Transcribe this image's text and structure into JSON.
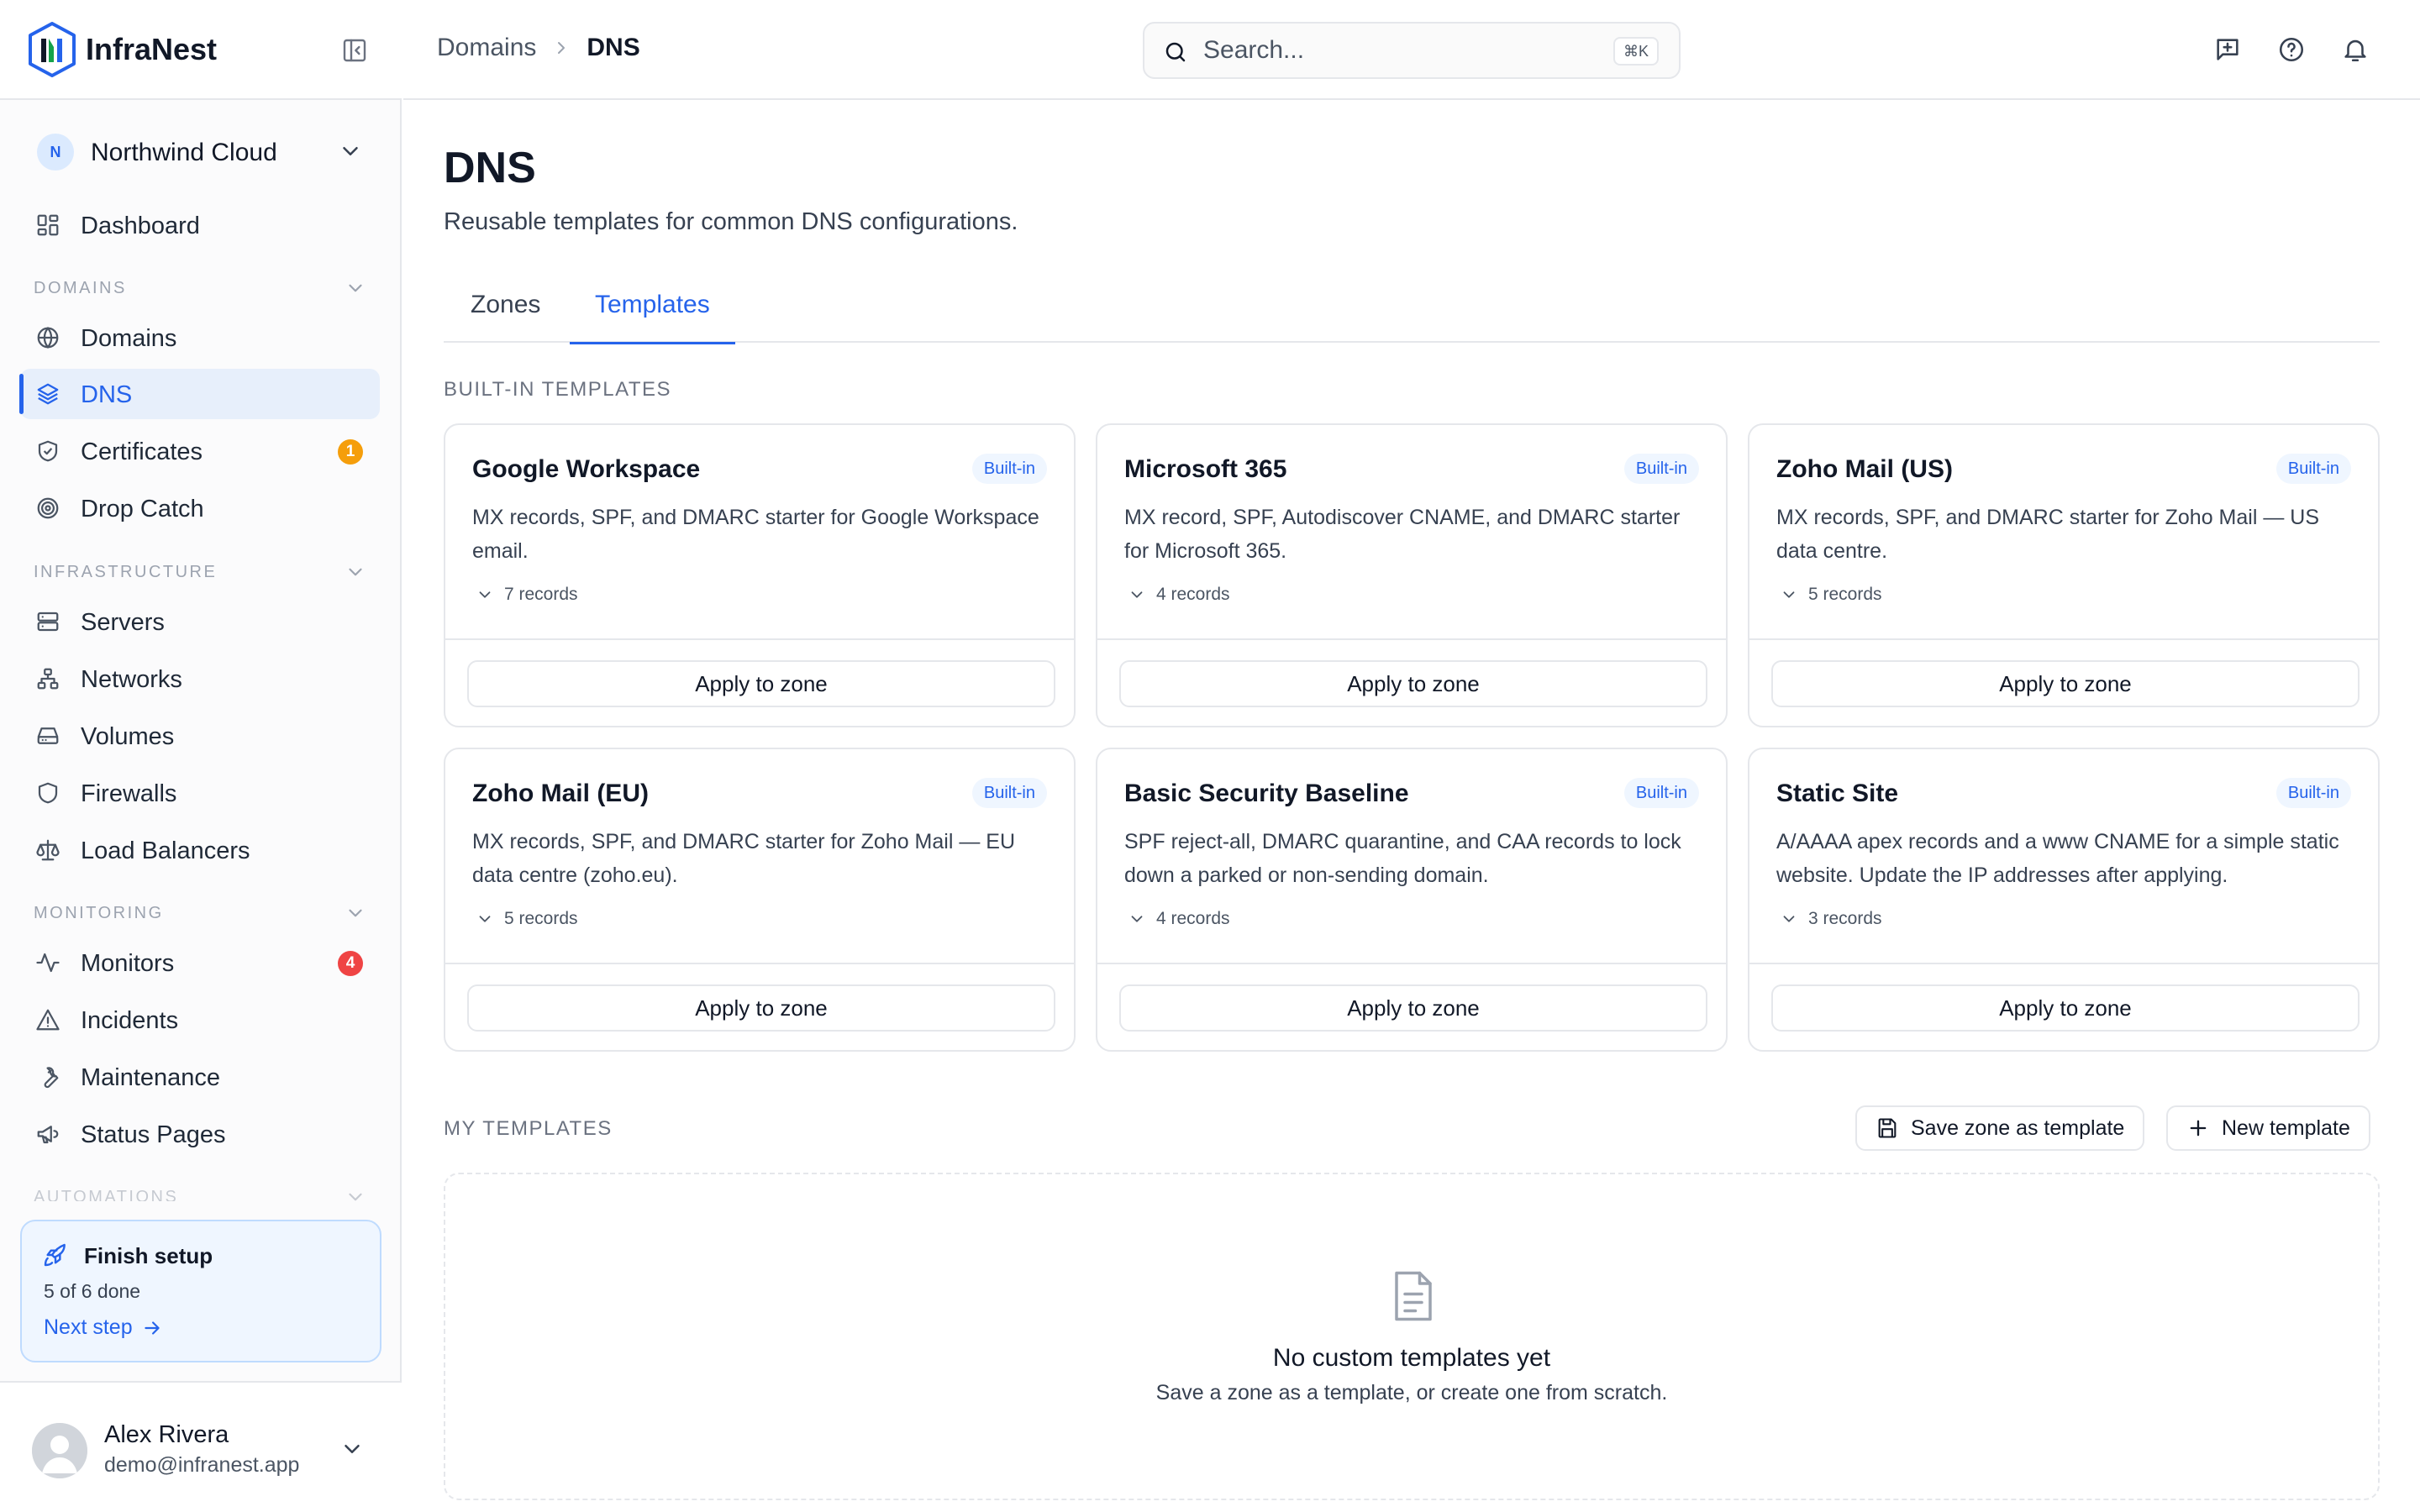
{
  "app": {
    "name": "InfraNest"
  },
  "org": {
    "initial": "N",
    "name": "Northwind Cloud"
  },
  "sidebar": {
    "dashboard": "Dashboard",
    "sections": {
      "domains": "DOMAINS",
      "infrastructure": "INFRASTRUCTURE",
      "monitoring": "MONITORING",
      "automations": "AUTOMATIONS"
    },
    "items": {
      "domains": "Domains",
      "dns": "DNS",
      "certificates": "Certificates",
      "certificates_badge": "1",
      "drop_catch": "Drop Catch",
      "servers": "Servers",
      "networks": "Networks",
      "volumes": "Volumes",
      "firewalls": "Firewalls",
      "load_balancers": "Load Balancers",
      "monitors": "Monitors",
      "monitors_badge": "4",
      "incidents": "Incidents",
      "maintenance": "Maintenance",
      "status_pages": "Status Pages"
    }
  },
  "setup": {
    "title": "Finish setup",
    "progress": "5 of 6 done",
    "link": "Next step"
  },
  "user": {
    "name": "Alex Rivera",
    "email": "demo@infranest.app"
  },
  "topbar": {
    "breadcrumb": {
      "parent": "Domains",
      "current": "DNS"
    },
    "search": {
      "placeholder": "Search...",
      "shortcut": "⌘K"
    }
  },
  "page": {
    "title": "DNS",
    "description": "Reusable templates for common DNS configurations.",
    "tabs": {
      "zones": "Zones",
      "templates": "Templates"
    }
  },
  "builtin": {
    "heading": "BUILT-IN TEMPLATES",
    "apply_label": "Apply to zone",
    "badge": "Built-in",
    "templates": [
      {
        "name": "Google Workspace",
        "description": "MX records, SPF, and DMARC starter for Google Workspace email.",
        "records": "7 records"
      },
      {
        "name": "Microsoft 365",
        "description": "MX record, SPF, Autodiscover CNAME, and DMARC starter for Microsoft 365.",
        "records": "4 records"
      },
      {
        "name": "Zoho Mail (US)",
        "description": "MX records, SPF, and DMARC starter for Zoho Mail — US data centre.",
        "records": "5 records"
      },
      {
        "name": "Zoho Mail (EU)",
        "description": "MX records, SPF, and DMARC starter for Zoho Mail — EU data centre (zoho.eu).",
        "records": "5 records"
      },
      {
        "name": "Basic Security Baseline",
        "description": "SPF reject-all, DMARC quarantine, and CAA records to lock down a parked or non-sending domain.",
        "records": "4 records"
      },
      {
        "name": "Static Site",
        "description": "A/AAAA apex records and a www CNAME for a simple static website. Update the IP addresses after applying.",
        "records": "3 records"
      }
    ]
  },
  "my_templates": {
    "heading": "MY TEMPLATES",
    "save_button": "Save zone as template",
    "new_button": "New template",
    "empty_title": "No custom templates yet",
    "empty_desc": "Save a zone as a template, or create one from scratch."
  },
  "colors": {
    "accent": "#2563eb",
    "badge_amber": "#f59e0b",
    "badge_red": "#ef4444",
    "border": "#e5e7eb"
  }
}
